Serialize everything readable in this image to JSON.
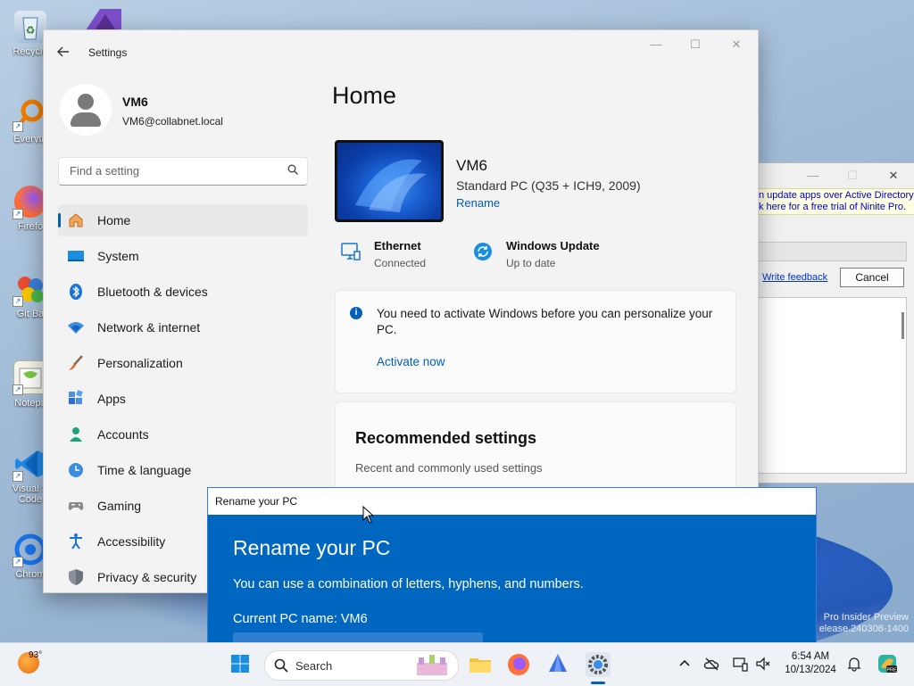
{
  "desktop": {
    "icons": [
      {
        "label": "Recycle"
      },
      {
        "label": "Everyth"
      },
      {
        "label": "Firefo"
      },
      {
        "label": "Git Ba"
      },
      {
        "label": "Notepa"
      },
      {
        "label": "Visual S"
      },
      {
        "label": "Code"
      },
      {
        "label": "Chrom"
      }
    ],
    "watermark_line1": "Pro Insider Preview",
    "watermark_line2": "elease.240308-1400"
  },
  "settings": {
    "window_title": "Settings",
    "controls": {
      "minimize": "—",
      "maximize": "☐",
      "close": "✕"
    },
    "profile": {
      "name": "VM6",
      "email": "VM6@collabnet.local"
    },
    "search": {
      "placeholder": "Find a setting"
    },
    "nav": [
      {
        "label": "Home",
        "icon": "home-icon",
        "active": true
      },
      {
        "label": "System",
        "icon": "system-icon"
      },
      {
        "label": "Bluetooth & devices",
        "icon": "bluetooth-icon"
      },
      {
        "label": "Network & internet",
        "icon": "wifi-icon"
      },
      {
        "label": "Personalization",
        "icon": "brush-icon"
      },
      {
        "label": "Apps",
        "icon": "apps-icon"
      },
      {
        "label": "Accounts",
        "icon": "accounts-icon"
      },
      {
        "label": "Time & language",
        "icon": "clock-globe-icon"
      },
      {
        "label": "Gaming",
        "icon": "gamepad-icon"
      },
      {
        "label": "Accessibility",
        "icon": "accessibility-icon"
      },
      {
        "label": "Privacy & security",
        "icon": "shield-icon"
      }
    ],
    "home": {
      "title": "Home",
      "device": {
        "name": "VM6",
        "model": "Standard PC (Q35 + ICH9, 2009)",
        "rename": "Rename"
      },
      "ethernet": {
        "title": "Ethernet",
        "status": "Connected"
      },
      "update": {
        "title": "Windows Update",
        "status": "Up to date"
      },
      "activation": {
        "message": "You need to activate Windows before you can personalize your PC.",
        "link": "Activate now"
      },
      "recommended": {
        "title": "Recommended settings",
        "subtitle": "Recent and commonly used settings"
      }
    }
  },
  "ninite": {
    "banner_line1": "n update apps over Active Directory.",
    "banner_line2": "k here for a free trial of Ninite Pro.",
    "feedback": "Write feedback",
    "cancel": "Cancel"
  },
  "rename_dialog": {
    "bar_title": "Rename your PC",
    "heading": "Rename your PC",
    "hint": "You can use a combination of letters, hyphens, and numbers.",
    "current": "Current PC name: VM6"
  },
  "taskbar": {
    "weather_temp": "93°",
    "search_label": "Search",
    "time": "6:54 AM",
    "date": "10/13/2024"
  },
  "colors": {
    "accent": "#005fb8",
    "dialog_blue": "#0067c0"
  }
}
